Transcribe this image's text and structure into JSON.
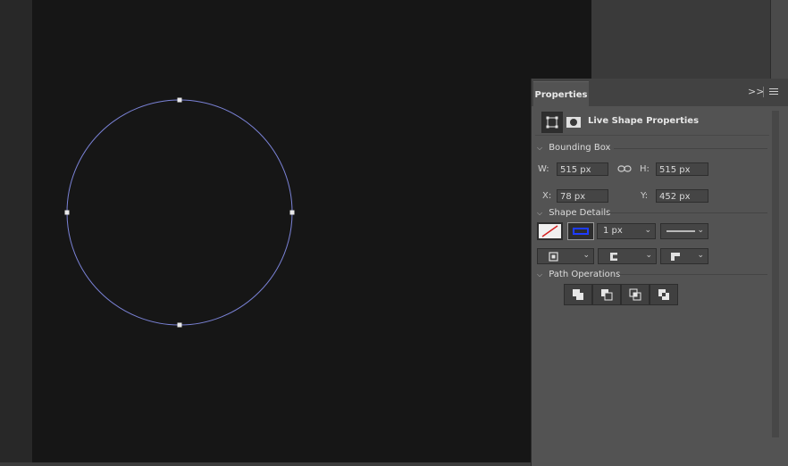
{
  "panel": {
    "tab_label": "Properties",
    "collapse_label": ">>",
    "header_title": "Live Shape Properties"
  },
  "bounding_box": {
    "title": "Bounding Box",
    "w_label": "W:",
    "w_value": "515 px",
    "h_label": "H:",
    "h_value": "515 px",
    "x_label": "X:",
    "x_value": "78 px",
    "y_label": "Y:",
    "y_value": "452 px"
  },
  "shape_details": {
    "title": "Shape Details",
    "stroke_width": "1 px",
    "fill_swatch": "none",
    "stroke_color": "#1e3cff"
  },
  "path_operations": {
    "title": "Path Operations",
    "buttons": [
      "combine-shapes",
      "subtract-front-shape",
      "intersect-shape-areas",
      "exclude-overlapping-shapes"
    ]
  },
  "colors": {
    "canvas": "#161616",
    "panel": "#535353",
    "circle_path": "#7a82d6"
  }
}
